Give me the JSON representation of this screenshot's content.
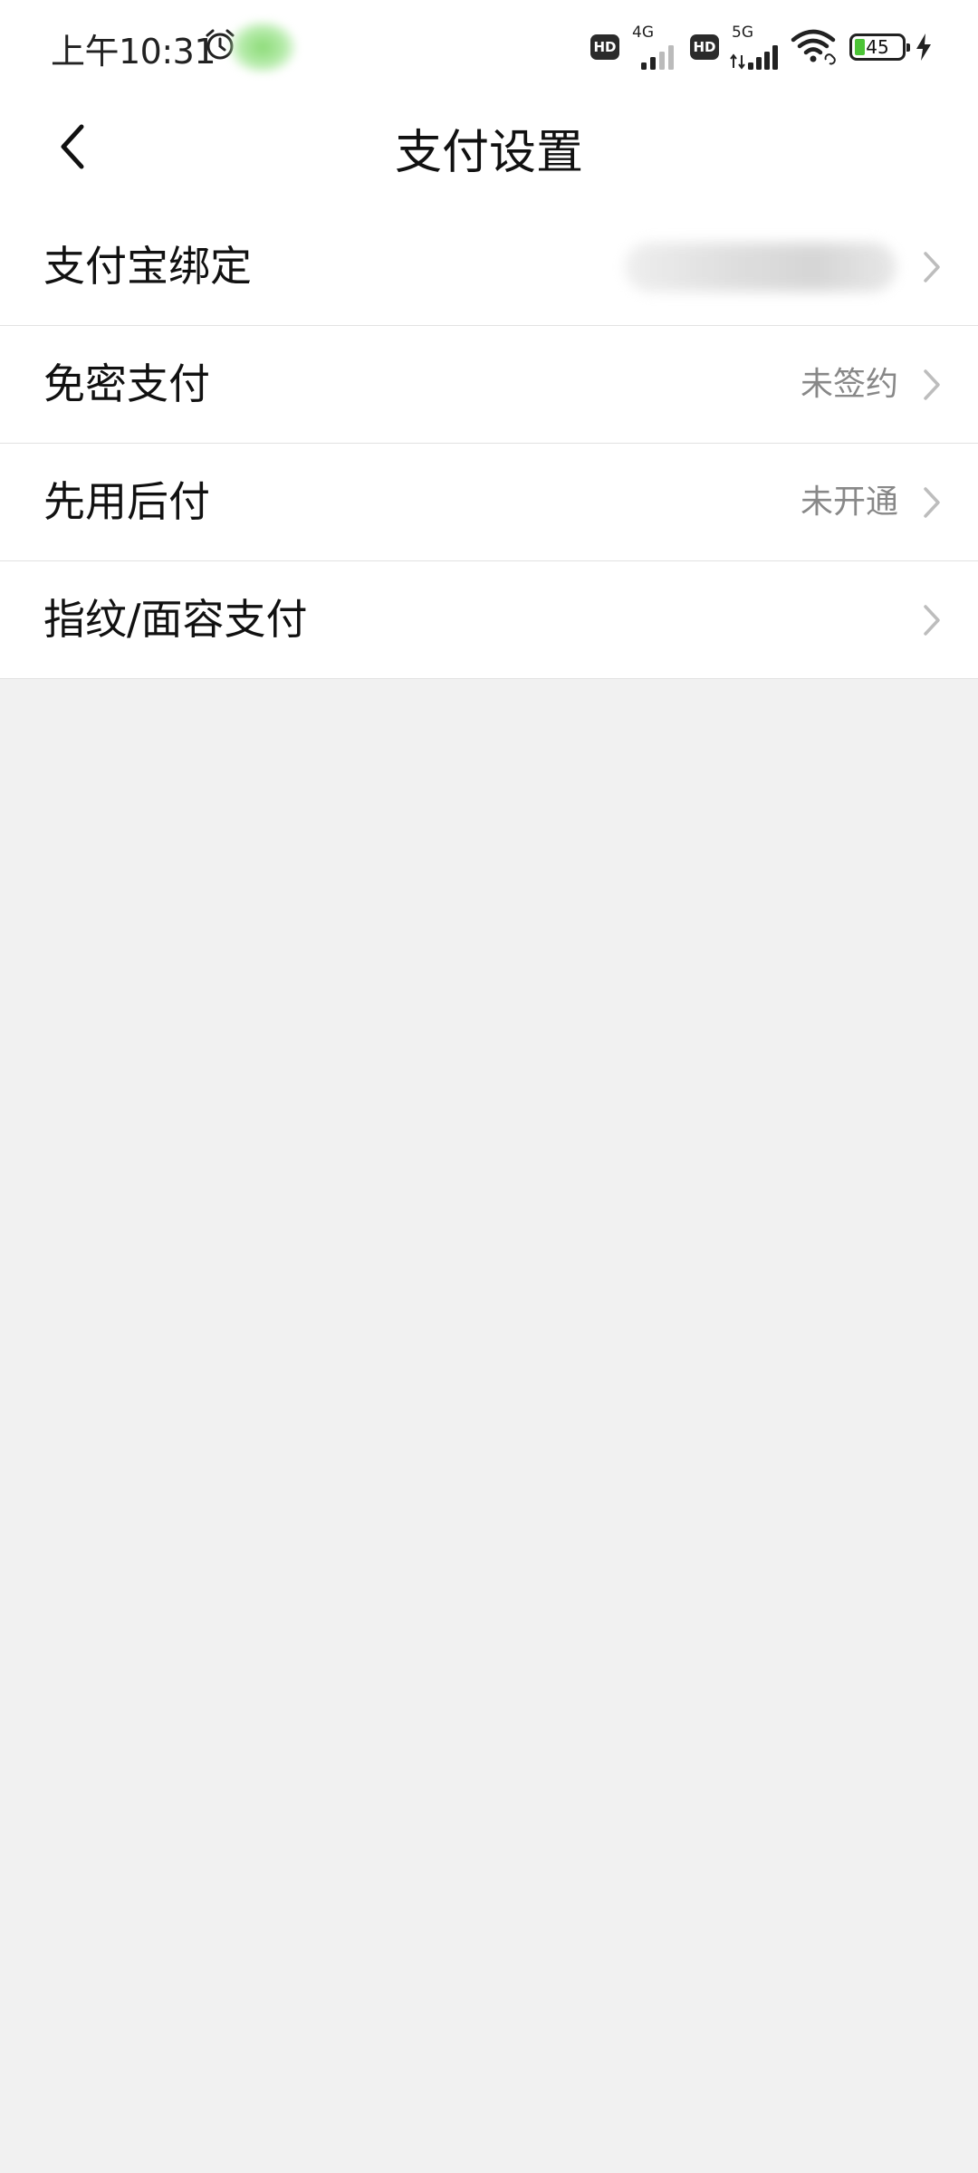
{
  "status_bar": {
    "time": "上午10:31",
    "hd_badge_1": "HD",
    "network_1": "4G",
    "hd_badge_2": "HD",
    "network_2": "5G",
    "battery_level": "45",
    "charging": true,
    "icons": [
      "alarm-icon",
      "signal-icon",
      "wifi-icon",
      "battery-icon",
      "charging-bolt-icon"
    ]
  },
  "header": {
    "title": "支付设置",
    "back_icon": "chevron-left-icon"
  },
  "settings": {
    "rows": [
      {
        "label": "支付宝绑定",
        "value": "",
        "value_blurred": true
      },
      {
        "label": "免密支付",
        "value": "未签约"
      },
      {
        "label": "先用后付",
        "value": "未开通"
      },
      {
        "label": "指纹/面容支付",
        "value": ""
      }
    ],
    "row_icon": "chevron-right-icon"
  },
  "colors": {
    "page_background": "#f1f1f1",
    "surface": "#ffffff",
    "divider": "#e2e2e2",
    "secondary_text": "#888888",
    "battery_fill": "#4cc437"
  }
}
